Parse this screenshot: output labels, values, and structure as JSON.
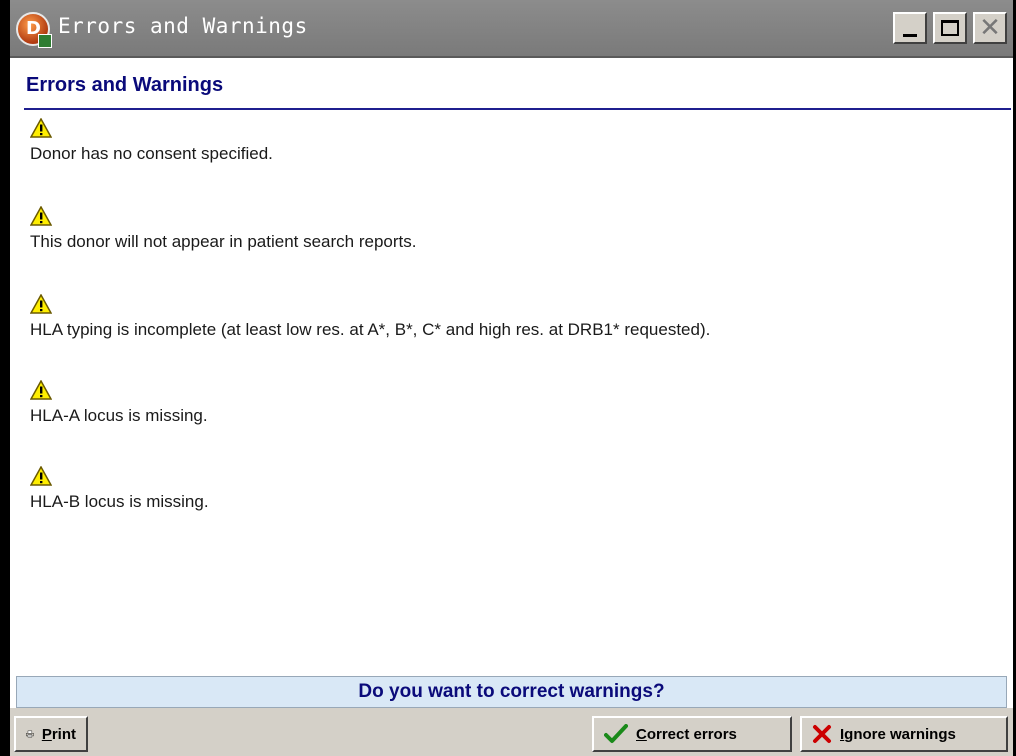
{
  "window": {
    "title": "Errors and Warnings"
  },
  "heading": "Errors and Warnings",
  "messages": [
    {
      "type": "warning",
      "text": "Donor has no consent specified."
    },
    {
      "type": "warning",
      "text": "This donor will not appear in patient search reports."
    },
    {
      "type": "warning",
      "text": "HLA typing is incomplete (at least low res. at A*, B*, C* and high res. at DRB1* requested)."
    },
    {
      "type": "warning",
      "text": "HLA-A locus is missing."
    },
    {
      "type": "warning",
      "text": "HLA-B locus is missing."
    }
  ],
  "prompt": "Do you want to correct warnings?",
  "buttons": {
    "print": {
      "mnemonic": "P",
      "rest": "rint",
      "icon": "printer-icon"
    },
    "correct": {
      "mnemonic": "C",
      "rest": "orrect errors",
      "icon": "checkmark-icon"
    },
    "ignore": {
      "mnemonic": "I",
      "rest": "gnore warnings",
      "icon": "red-x-icon"
    }
  },
  "colors": {
    "accent": "#0a0a7a",
    "warning_fill": "#ffee00",
    "prompt_bg": "#d9e8f6",
    "titlebar": "#808080"
  }
}
